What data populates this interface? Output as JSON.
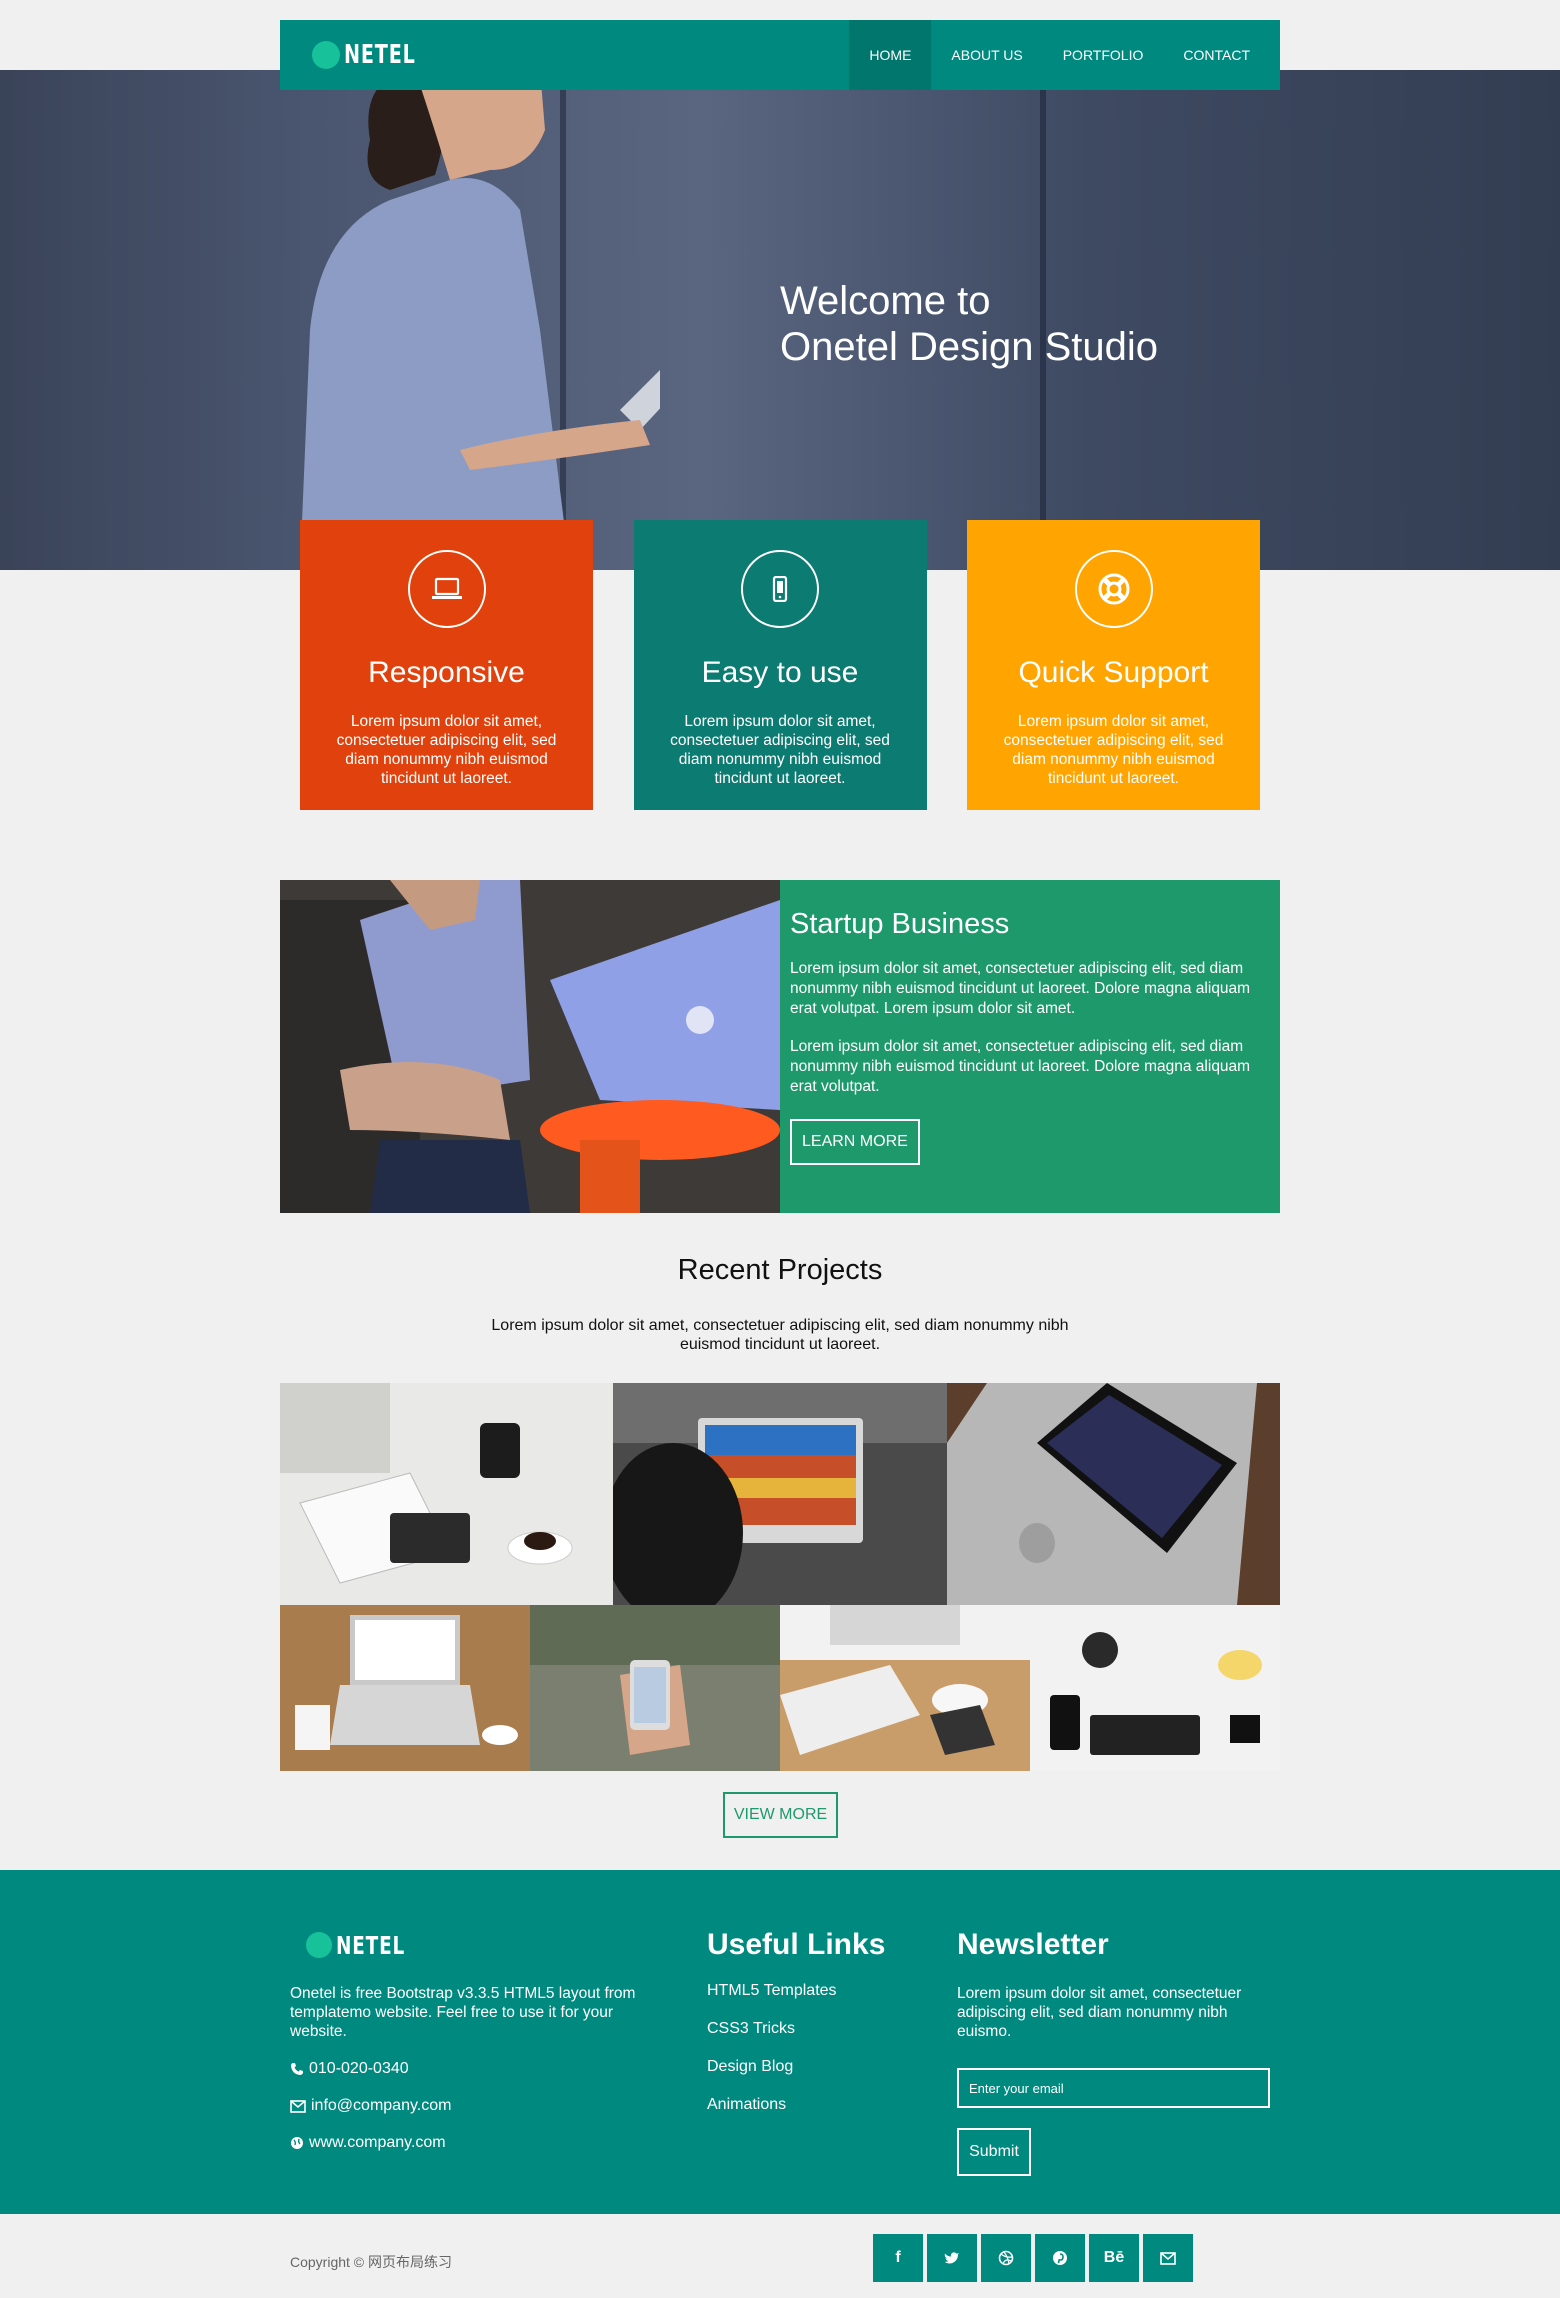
{
  "brand": {
    "logo_text": "NETEL",
    "accent": "#00897f",
    "logo_dot": "#17c29a"
  },
  "nav": {
    "items": [
      {
        "label": "HOME",
        "active": true
      },
      {
        "label": "ABOUT US",
        "active": false
      },
      {
        "label": "PORTFOLIO",
        "active": false
      },
      {
        "label": "CONTACT",
        "active": false
      }
    ]
  },
  "hero": {
    "line1": "Welcome to",
    "line2": "Onetel Design Studio"
  },
  "features": [
    {
      "title": "Responsive",
      "text": "Lorem ipsum dolor sit amet, consectetuer adipiscing elit, sed diam nonummy nibh euismod tincidunt ut laoreet.",
      "icon": "laptop-icon",
      "color": "#e1420d"
    },
    {
      "title": "Easy to use",
      "text": "Lorem ipsum dolor sit amet, consectetuer adipiscing elit, sed diam nonummy nibh euismod tincidunt ut laoreet.",
      "icon": "mobile-icon",
      "color": "#0c7b72"
    },
    {
      "title": "Quick Support",
      "text": "Lorem ipsum dolor sit amet, consectetuer adipiscing elit, sed diam nonummy nibh euismod tincidunt ut laoreet.",
      "icon": "lifebuoy-icon",
      "color": "#ffa401"
    }
  ],
  "startup": {
    "title": "Startup Business",
    "p1": "Lorem ipsum dolor sit amet, consectetuer adipiscing elit, sed diam nonummy nibh euismod tincidunt ut laoreet. Dolore magna aliquam erat volutpat. Lorem ipsum dolor sit amet.",
    "p2": "Lorem ipsum dolor sit amet, consectetuer adipiscing elit, sed diam nonummy nibh euismod tincidunt ut laoreet. Dolore magna aliquam erat volutpat.",
    "button": "LEARN MORE",
    "color": "#1e996b"
  },
  "projects": {
    "title": "Recent Projects",
    "description": "Lorem ipsum dolor sit amet, consectetuer adipiscing elit, sed diam nonummy nibh euismod tincidunt ut laoreet.",
    "button": "VIEW MORE"
  },
  "footer": {
    "about": "Onetel is free Bootstrap v3.3.5 HTML5 layout from templatemo website. Feel free to use it for your website.",
    "phone": "010-020-0340",
    "email": "info@company.com",
    "website": "www.company.com",
    "links_heading": "Useful Links",
    "links": [
      "HTML5 Templates",
      "CSS3 Tricks",
      "Design Blog",
      "Animations"
    ],
    "newsletter_heading": "Newsletter",
    "newsletter_text": "Lorem ipsum dolor sit amet, consectetuer adipiscing elit, sed diam nonummy nibh euismo.",
    "email_placeholder": "Enter your email",
    "submit": "Submit"
  },
  "bottom": {
    "copyright": "Copyright © 网页布局练习",
    "social": [
      {
        "glyph": "f",
        "icon": "facebook-icon"
      },
      {
        "glyph": "t",
        "icon": "twitter-icon"
      },
      {
        "glyph": "",
        "icon": "dribbble-icon"
      },
      {
        "glyph": "",
        "icon": "pinterest-icon"
      },
      {
        "glyph": "Bē",
        "icon": "behance-icon"
      },
      {
        "glyph": "",
        "icon": "envelope-icon"
      }
    ]
  }
}
